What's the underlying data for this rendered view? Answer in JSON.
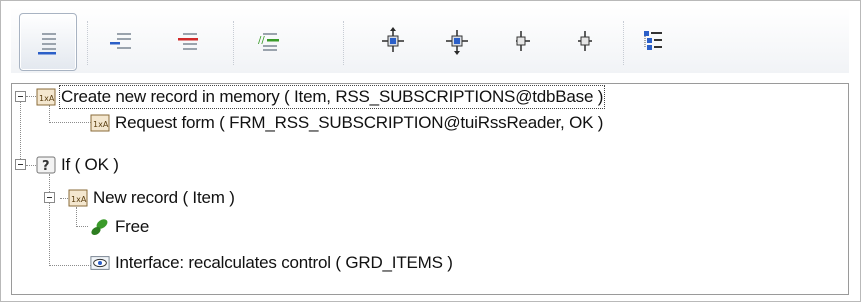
{
  "toolbar": {
    "buttons": [
      {
        "name": "indent-lines-button",
        "active": true
      },
      {
        "name": "outdent-blue-button",
        "active": false
      },
      {
        "name": "outdent-red-button",
        "active": false
      },
      {
        "name": "comment-lines-button",
        "active": false
      },
      {
        "name": "move-crosshair-blue-button",
        "active": false
      },
      {
        "name": "move-crosshair-blue-2-button",
        "active": false
      },
      {
        "name": "move-crosshair-gray-button",
        "active": false
      },
      {
        "name": "move-crosshair-gray-2-button",
        "active": false
      },
      {
        "name": "tree-view-button",
        "active": false
      }
    ]
  },
  "tree": {
    "nodes": [
      {
        "id": "n1",
        "label": "Create new record in memory ( Item, RSS_SUBSCRIPTIONS@tdbBase )",
        "icon": "action-icon",
        "selected": true
      },
      {
        "id": "n2",
        "label": "Request form ( FRM_RSS_SUBSCRIPTION@tuiRssReader, OK )",
        "icon": "action-icon"
      },
      {
        "id": "n3",
        "label": "If ( OK )",
        "icon": "question-icon"
      },
      {
        "id": "n4",
        "label": "New record ( Item )",
        "icon": "action-icon"
      },
      {
        "id": "n5",
        "label": "Free",
        "icon": "leaf-icon"
      },
      {
        "id": "n6",
        "label": "Interface: recalculates control ( GRD_ITEMS )",
        "icon": "eye-icon"
      }
    ]
  },
  "colors": {
    "blue": "#2b5fc8",
    "red": "#d12b2b",
    "green": "#3a9b2a",
    "text": "#111111"
  }
}
